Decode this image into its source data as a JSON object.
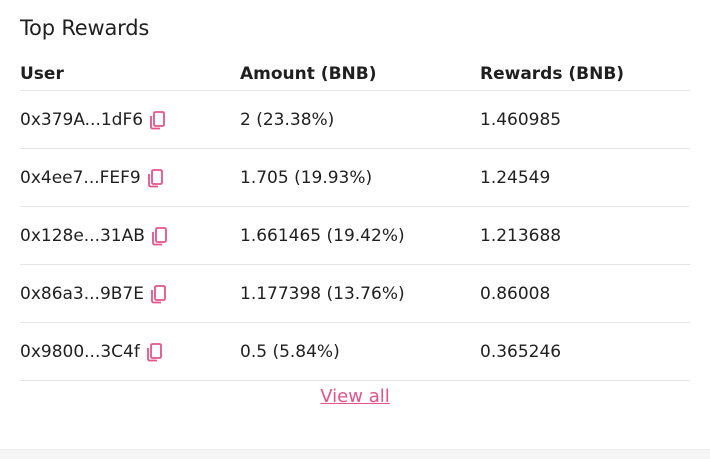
{
  "title": "Top Rewards",
  "columns": {
    "user": "User",
    "amount": "Amount (BNB)",
    "rewards": "Rewards (BNB)"
  },
  "rows": [
    {
      "user": "0x379A...1dF6",
      "amount": "2 (23.38%)",
      "rewards": "1.460985"
    },
    {
      "user": "0x4ee7...FEF9",
      "amount": "1.705 (19.93%)",
      "rewards": "1.24549"
    },
    {
      "user": "0x128e...31AB",
      "amount": "1.661465 (19.42%)",
      "rewards": "1.213688"
    },
    {
      "user": "0x86a3...9B7E",
      "amount": "1.177398 (13.76%)",
      "rewards": "0.86008"
    },
    {
      "user": "0x9800...3C4f",
      "amount": "0.5 (5.84%)",
      "rewards": "0.365246"
    }
  ],
  "view_all_label": "View all",
  "colors": {
    "accent": "#e6538a",
    "divider": "#e6e6e6",
    "text": "#1f1f1f"
  },
  "icons": {
    "copy": "copy-icon"
  }
}
